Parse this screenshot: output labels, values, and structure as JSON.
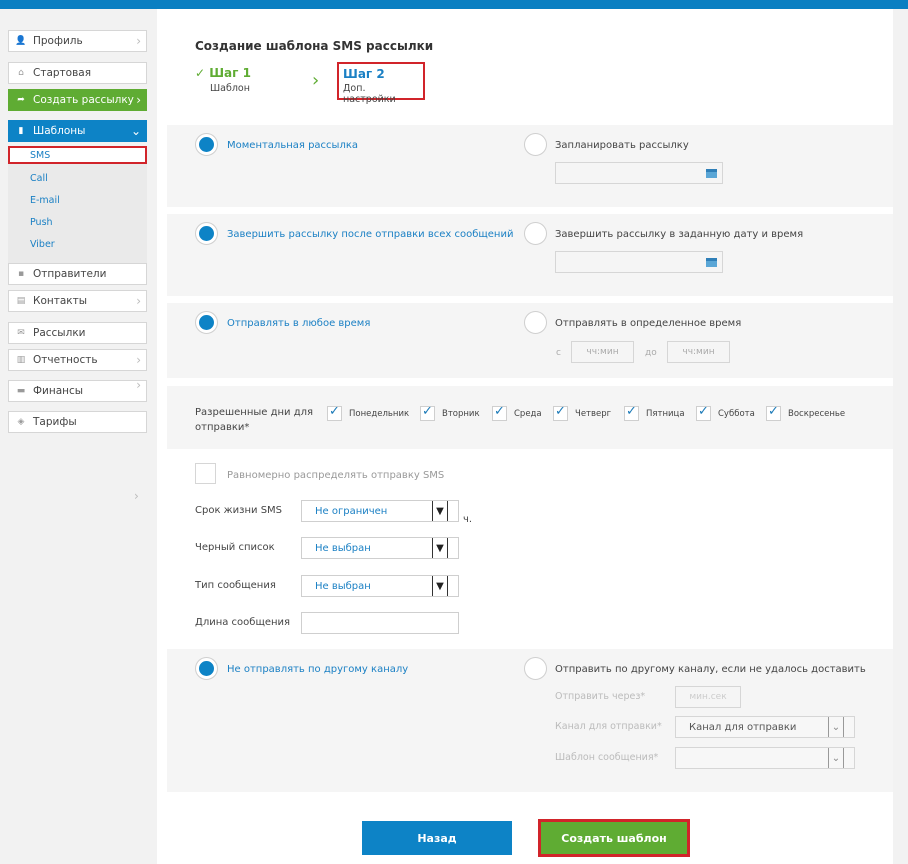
{
  "sidebar": {
    "profile": "Профиль",
    "start": "Стартовая",
    "create": "Создать рассылку",
    "templates": "Шаблоны",
    "template_items": [
      "SMS",
      "Call",
      "E-mail",
      "Push",
      "Viber"
    ],
    "senders": "Отправители",
    "contacts": "Контакты",
    "mailings": "Рассылки",
    "reports": "Отчетность",
    "finance": "Финансы",
    "tariffs": "Тарифы"
  },
  "header": {
    "title": "Создание шаблона SMS рассылки",
    "step1_title": "Шаг 1",
    "step1_sub": "Шаблон",
    "step2_title": "Шаг 2",
    "step2_sub": "Доп. настройки"
  },
  "sending": {
    "instant": "Моментальная рассылка",
    "scheduled": "Запланировать рассылку"
  },
  "finish": {
    "after_all": "Завершить рассылку после отправки всех сообщений",
    "at_date": "Завершить рассылку в заданную дату и время"
  },
  "time": {
    "any": "Отправлять в любое время",
    "specific": "Отправлять в определенное время",
    "from": "с",
    "to": "до",
    "placeholder": "чч:мин"
  },
  "days": {
    "label": "Разрешенные дни для отправки*",
    "items": [
      "Понедельник",
      "Вторник",
      "Среда",
      "Четверг",
      "Пятница",
      "Суббота",
      "Воскресенье"
    ]
  },
  "options": {
    "distribute": "Равномерно распределять отправку SMS",
    "lifetime_label": "Срок жизни SMS",
    "lifetime_value": "Не ограничен",
    "lifetime_unit": "ч.",
    "blacklist_label": "Черный список",
    "blacklist_value": "Не выбран",
    "type_label": "Тип сообщения",
    "type_value": "Не выбран",
    "length_label": "Длина сообщения"
  },
  "channel": {
    "no_other": "Не отправлять по другому каналу",
    "other": "Отправить по другому каналу, если не удалось доставить",
    "send_via": "Отправить через*",
    "send_via_placeholder": "мин.сек",
    "channel_label": "Канал для отправки*",
    "channel_value": "Канал для отправки",
    "template_label": "Шаблон сообщения*"
  },
  "actions": {
    "back": "Назад",
    "create": "Создать шаблон"
  }
}
